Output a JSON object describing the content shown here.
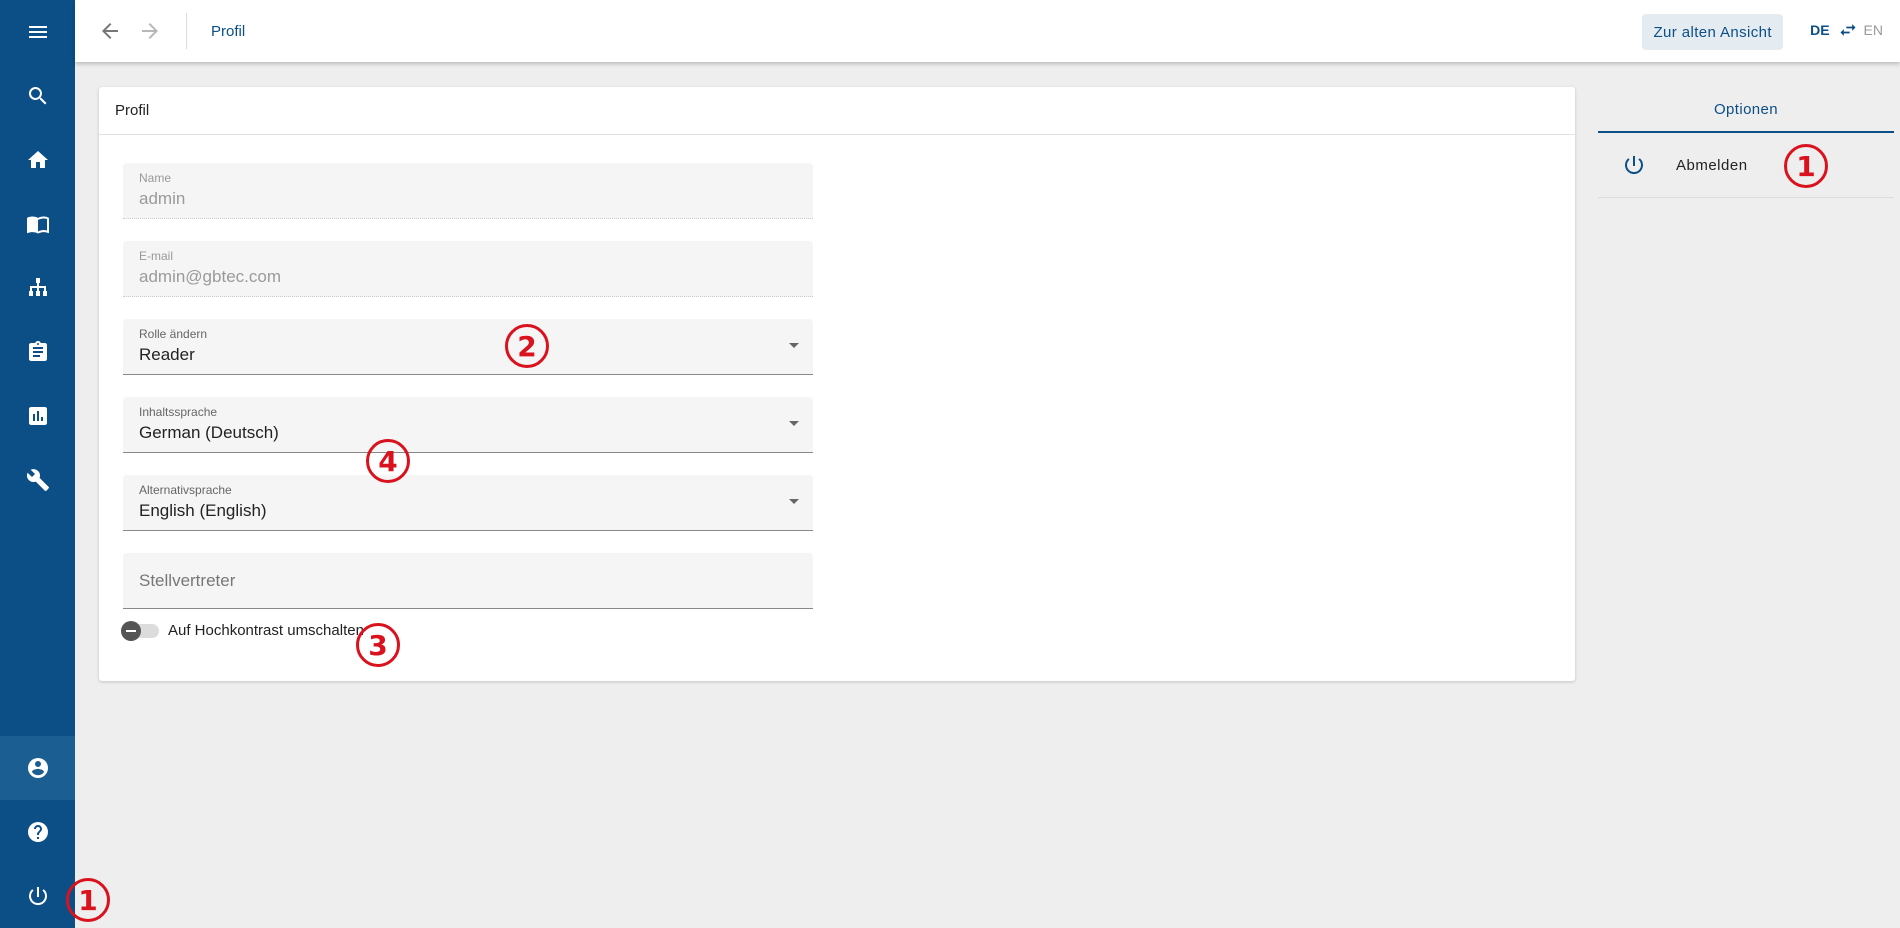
{
  "topbar": {
    "breadcrumb": "Profil",
    "old_view_button": "Zur alten Ansicht",
    "lang_active": "DE",
    "lang_inactive": "EN"
  },
  "sidebar": {
    "items": [
      {
        "icon": "menu-icon"
      },
      {
        "icon": "search-icon"
      },
      {
        "icon": "home-icon"
      },
      {
        "icon": "book-icon"
      },
      {
        "icon": "hierarchy-icon"
      },
      {
        "icon": "clipboard-icon"
      },
      {
        "icon": "chart-icon"
      },
      {
        "icon": "wrench-icon"
      }
    ],
    "bottom": [
      {
        "icon": "account-icon",
        "active": true
      },
      {
        "icon": "help-icon"
      },
      {
        "icon": "power-icon"
      }
    ]
  },
  "profile": {
    "card_title": "Profil",
    "name": {
      "label": "Name",
      "value": "admin"
    },
    "email": {
      "label": "E-mail",
      "value": "admin@gbtec.com"
    },
    "role": {
      "label": "Rolle ändern",
      "value": "Reader"
    },
    "content_language": {
      "label": "Inhaltssprache",
      "value": "German (Deutsch)"
    },
    "alt_language": {
      "label": "Alternativsprache",
      "value": "English (English)"
    },
    "deputy": {
      "placeholder": "Stellvertreter"
    },
    "high_contrast": {
      "label": "Auf Hochkontrast umschalten",
      "enabled": false
    }
  },
  "options": {
    "tab_label": "Optionen",
    "logout_label": "Abmelden"
  },
  "annotations": {
    "marker_logout_panel": "1",
    "marker_logout_sidebar": "1",
    "marker_role": "2",
    "marker_contrast": "3",
    "marker_language": "4"
  },
  "colors": {
    "primary": "#0b4f86",
    "marker": "#d9121e",
    "background": "#eeeeee"
  }
}
